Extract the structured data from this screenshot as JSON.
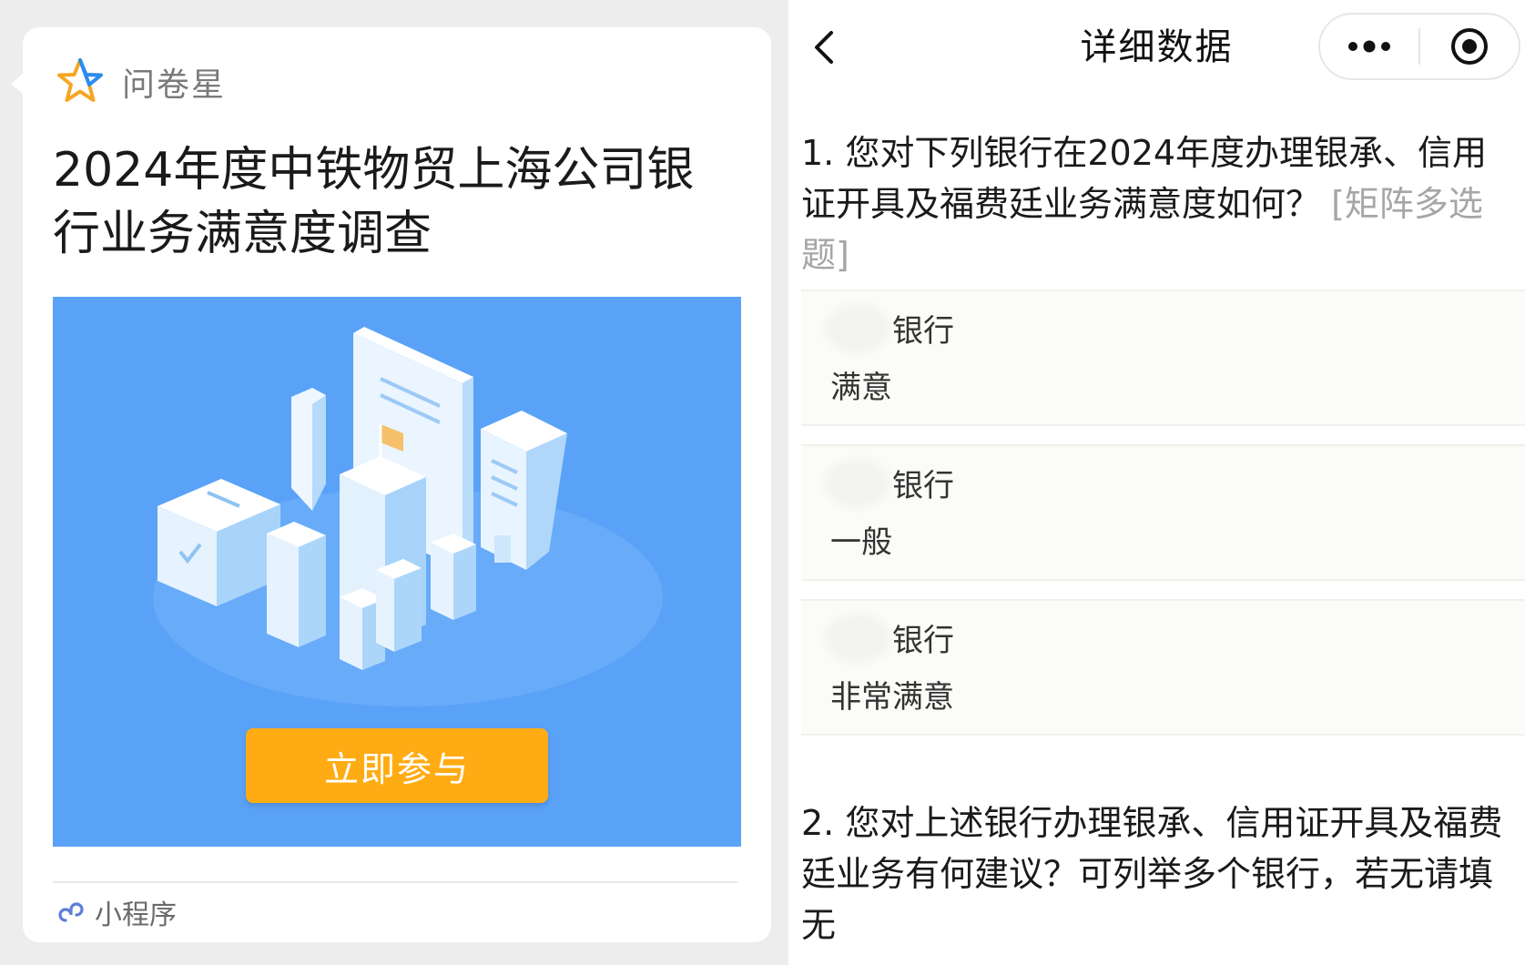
{
  "share_card": {
    "brand_name": "问卷星",
    "title": "2024年度中铁物贸上海公司银行业务满意度调查",
    "join_button": "立即参与",
    "mini_program_label": "小程序",
    "colors": {
      "banner": "#5aa2f8",
      "button": "#ffac14",
      "brand_star": "#f5a623"
    }
  },
  "detail_page": {
    "nav": {
      "title": "详细数据",
      "back_icon": "chevron-left-icon",
      "more_icon": "more-dots-icon",
      "close_icon": "target-circle-icon"
    },
    "question1": {
      "text": "1. 您对下列银行在2024年度办理银承、信用证开具及福费廷业务满意度如何？",
      "type_label": "[矩阵多选题]",
      "answers": [
        {
          "bank": "银行",
          "value": "满意"
        },
        {
          "bank": "银行",
          "value": "一般"
        },
        {
          "bank": "银行",
          "value": "非常满意"
        }
      ]
    },
    "question2": {
      "text": "2. 您对上述银行办理银承、信用证开具及福费廷业务有何建议？可列举多个银行，若无请填无"
    }
  }
}
